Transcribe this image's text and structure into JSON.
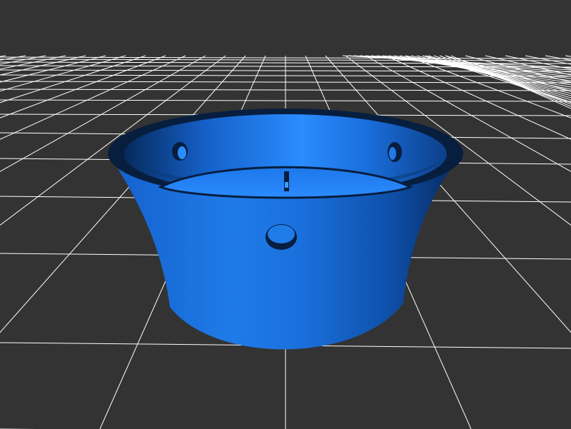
{
  "scene": {
    "background_color": "#333333",
    "grid_color": "#ffffff",
    "model_color": "#1e78e6",
    "model_dark_color": "#0a2a55",
    "model_light_color": "#3a9cff",
    "objects": [
      "ground-grid",
      "cup-model"
    ],
    "model_features": {
      "shape": "flared cylindrical shell",
      "holes": [
        "front-hole",
        "inner-left-hole",
        "inner-right-hole"
      ],
      "slot": "inner-slot"
    }
  }
}
